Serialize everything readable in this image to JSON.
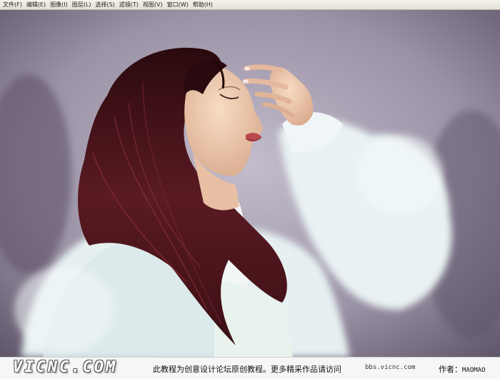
{
  "menu": {
    "items": [
      {
        "label": "文件(F)"
      },
      {
        "label": "编辑(E)"
      },
      {
        "label": "图像(I)"
      },
      {
        "label": "图层(L)"
      },
      {
        "label": "选择(S)"
      },
      {
        "label": "滤镜(T)"
      },
      {
        "label": "视图(V)"
      },
      {
        "label": "窗口(W)"
      },
      {
        "label": "帮助(H)"
      }
    ]
  },
  "footer": {
    "logo_text": "VICNC.COM",
    "notice": "此教程为创意设计论坛原创教程。更多精采作品请访问",
    "url": "bbs.vicnc.com",
    "author_label": "作者：",
    "author_name": "MAOMAO"
  },
  "colors": {
    "background": "#8a8294",
    "hair": "#3a0f14",
    "coat": "#e6f0f1",
    "skin": "#f0d0b6"
  }
}
